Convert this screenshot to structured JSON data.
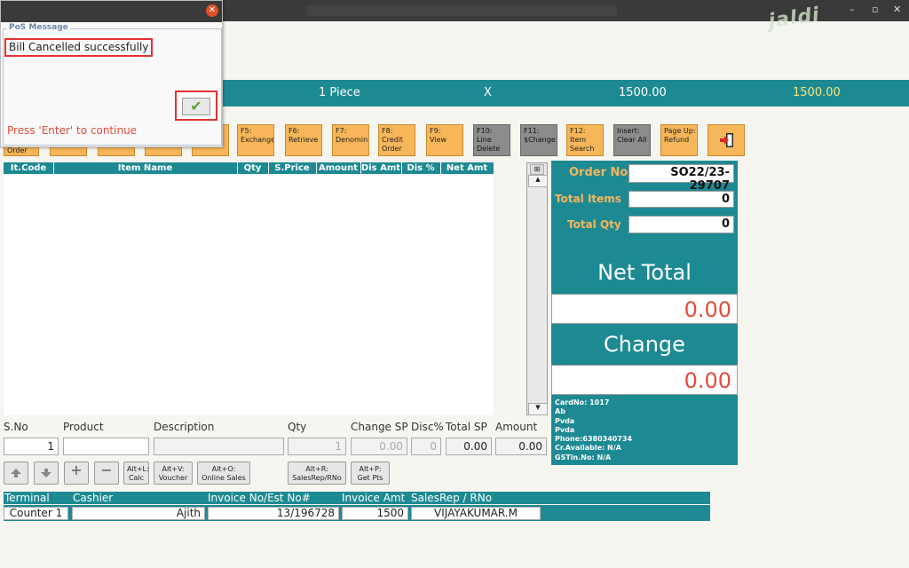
{
  "window": {
    "min": "–",
    "restore": "▫",
    "close": "✕",
    "brand": "jaldi"
  },
  "banner": {
    "unit": "1 Piece",
    "x": "X",
    "price": "1500.00",
    "total": "1500.00"
  },
  "fkeys": [
    {
      "label": "Order"
    },
    {
      "label": ""
    },
    {
      "label": ""
    },
    {
      "label": ""
    },
    {
      "label": "F5:\nExchange"
    },
    {
      "label": "F6:\nRetrieve"
    },
    {
      "label": "F7:\nDenomin"
    },
    {
      "label": "F8:\nCredit\nOrder"
    },
    {
      "label": "F9:\nView"
    },
    {
      "label": "F10:\nLine\nDelete"
    },
    {
      "label": "F11:\n$Change"
    },
    {
      "label": "F12:\nItem\nSearch"
    },
    {
      "label": "Insert:\nClear All"
    },
    {
      "label": "Page Up:\nRefund"
    }
  ],
  "table": {
    "headers": [
      "It.Code",
      "Item Name",
      "Qty",
      "S.Price",
      "Amount",
      "Dis Amt",
      "Dis %",
      "Net Amt"
    ]
  },
  "entry": {
    "labels": {
      "sno": "S.No",
      "product": "Product",
      "description": "Description",
      "qty": "Qty",
      "change_sp": "Change SP",
      "disc": "Disc%",
      "total_sp": "Total SP",
      "amount": "Amount"
    },
    "values": {
      "sno": "1",
      "product": "",
      "description": "",
      "qty": "1",
      "change_sp": "0.00",
      "disc": "0",
      "total_sp": "0.00",
      "amount": "0.00"
    }
  },
  "shortcuts": [
    {
      "label": "Alt+L:\nCalc"
    },
    {
      "label": "Alt+V:\nVoucher"
    },
    {
      "label": "Alt+O:\nOnline Sales"
    },
    {
      "label": "Alt+R:\nSalesRep/RNo"
    },
    {
      "label": "Alt+P:\nGet Pts"
    }
  ],
  "summary": {
    "order_no_label": "Order No",
    "order_no": "SO22/23-29707",
    "total_items_label": "Total Items",
    "total_items": "0",
    "total_qty_label": "Total Qty",
    "total_qty": "0",
    "net_total_label": "Net Total",
    "net_total": "0.00",
    "change_label": "Change",
    "change": "0.00",
    "customer": [
      "CardNo: 1017",
      "Ab",
      "Pvda",
      "Pvda",
      "Phone:6380340734",
      "Cr.Available: N/A",
      "GSTin.No: N/A"
    ]
  },
  "footer": {
    "headers": {
      "terminal": "Terminal",
      "cashier": "Cashier",
      "invoice": "Invoice No/Est No#",
      "amount": "Invoice Amt",
      "salesrep": "SalesRep / RNo"
    },
    "values": {
      "terminal": "Counter 1",
      "cashier": "Ajith",
      "invoice": "13/196728",
      "amount": "1500",
      "salesrep": "VIJAYAKUMAR.M"
    }
  },
  "dialog": {
    "group_title": "PoS Message",
    "message": "Bill Cancelled successfully",
    "hint": "Press 'Enter' to continue",
    "close": "✕",
    "ok": "✔"
  },
  "colors": {
    "teal": "#1d8a93",
    "orange": "#f6b659",
    "red": "#e34c3c",
    "background": "#f7f5f0"
  }
}
